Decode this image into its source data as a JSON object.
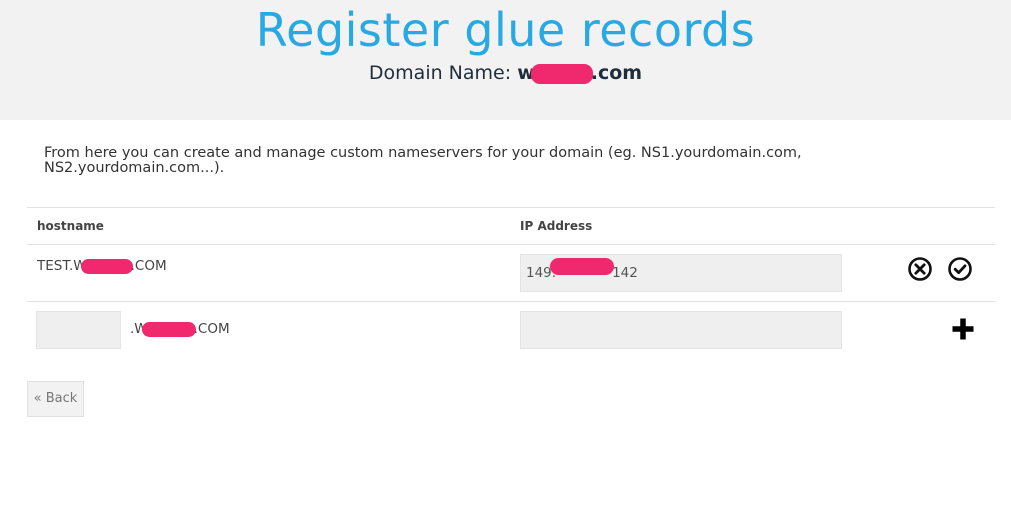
{
  "header": {
    "title": "Register glue records",
    "domain_label": "Domain Name:",
    "domain_prefix": "w",
    "domain_suffix": ".com"
  },
  "intro_text": "From here you can create and manage custom nameservers for your domain (eg. NS1.yourdomain.com, NS2.yourdomain.com...).",
  "table": {
    "columns": [
      "hostname",
      "IP Address"
    ],
    "rows": [
      {
        "hostname_prefix": "TEST.W",
        "hostname_suffix": ".COM",
        "ip_prefix": "149.",
        "ip_suffix": "142",
        "actions": [
          "remove-circle-icon",
          "check-circle-icon"
        ]
      }
    ],
    "new_row": {
      "hostname_value": "",
      "domain_prefix": ".W",
      "domain_suffix": ".COM",
      "ip_value": "",
      "action": "plus-icon"
    }
  },
  "back_button": "« Back",
  "colors": {
    "title": "#29a9e1",
    "redaction": "#f0286e",
    "header_bg": "#f2f2f2"
  }
}
